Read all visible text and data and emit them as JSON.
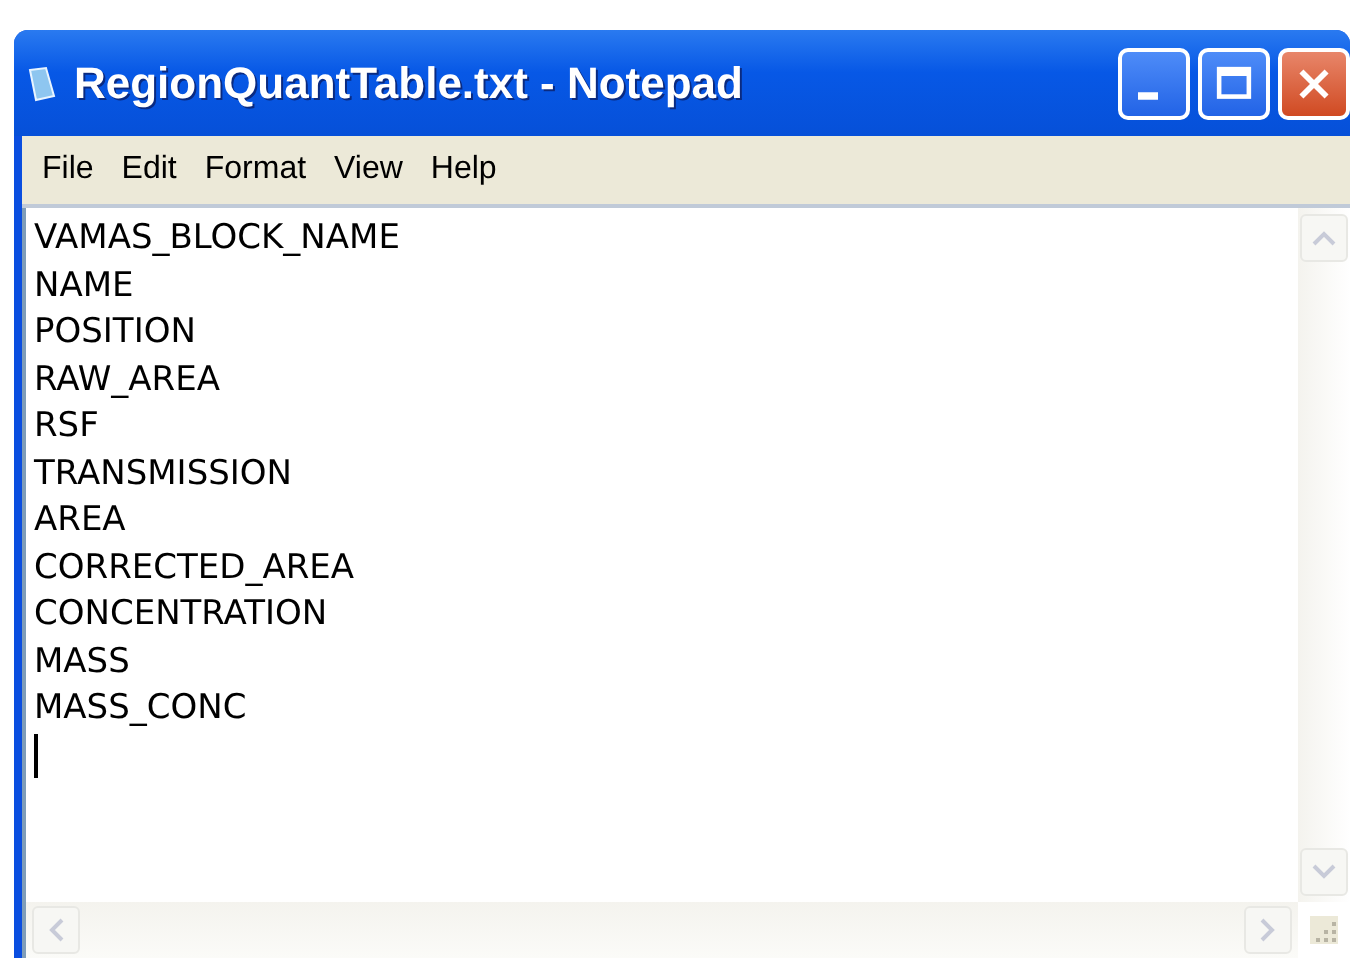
{
  "window": {
    "title": "RegionQuantTable.txt - Notepad"
  },
  "menu": [
    "File",
    "Edit",
    "Format",
    "View",
    "Help"
  ],
  "editor": {
    "lines": [
      "VAMAS_BLOCK_NAME",
      "NAME",
      "POSITION",
      "RAW_AREA",
      "RSF",
      "TRANSMISSION",
      "AREA",
      "CORRECTED_AREA",
      "CONCENTRATION",
      "MASS",
      "MASS_CONC"
    ]
  }
}
